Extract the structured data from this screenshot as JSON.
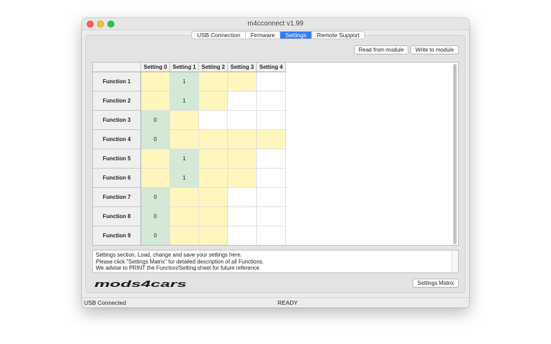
{
  "window": {
    "title": "m4cconnect v1.99"
  },
  "tabs": [
    {
      "label": "USB Connection",
      "active": false
    },
    {
      "label": "Firmware",
      "active": false
    },
    {
      "label": "Settings",
      "active": true
    },
    {
      "label": "Remote Support",
      "active": false
    }
  ],
  "toolbar": {
    "read_label": "Read from module",
    "write_label": "Write to module"
  },
  "matrix": {
    "columns": [
      "Setting 0",
      "Setting 1",
      "Setting 2",
      "Setting 3",
      "Setting 4"
    ],
    "rows": [
      {
        "label": "Function 1",
        "cells": [
          {
            "c": "y",
            "v": ""
          },
          {
            "c": "g",
            "v": "1"
          },
          {
            "c": "y",
            "v": ""
          },
          {
            "c": "y",
            "v": ""
          },
          {
            "c": "w",
            "v": ""
          }
        ]
      },
      {
        "label": "Function 2",
        "cells": [
          {
            "c": "y",
            "v": ""
          },
          {
            "c": "g",
            "v": "1"
          },
          {
            "c": "y",
            "v": ""
          },
          {
            "c": "w",
            "v": ""
          },
          {
            "c": "w",
            "v": ""
          }
        ]
      },
      {
        "label": "Function 3",
        "cells": [
          {
            "c": "g",
            "v": "0"
          },
          {
            "c": "y",
            "v": ""
          },
          {
            "c": "w",
            "v": ""
          },
          {
            "c": "w",
            "v": ""
          },
          {
            "c": "w",
            "v": ""
          }
        ]
      },
      {
        "label": "Function 4",
        "cells": [
          {
            "c": "g",
            "v": "0"
          },
          {
            "c": "y",
            "v": ""
          },
          {
            "c": "y",
            "v": ""
          },
          {
            "c": "y",
            "v": ""
          },
          {
            "c": "y",
            "v": ""
          }
        ]
      },
      {
        "label": "Function 5",
        "cells": [
          {
            "c": "y",
            "v": ""
          },
          {
            "c": "g",
            "v": "1"
          },
          {
            "c": "y",
            "v": ""
          },
          {
            "c": "y",
            "v": ""
          },
          {
            "c": "w",
            "v": ""
          }
        ]
      },
      {
        "label": "Function 6",
        "cells": [
          {
            "c": "y",
            "v": ""
          },
          {
            "c": "g",
            "v": "1"
          },
          {
            "c": "y",
            "v": ""
          },
          {
            "c": "y",
            "v": ""
          },
          {
            "c": "w",
            "v": ""
          }
        ]
      },
      {
        "label": "Function 7",
        "cells": [
          {
            "c": "g",
            "v": "0"
          },
          {
            "c": "y",
            "v": ""
          },
          {
            "c": "y",
            "v": ""
          },
          {
            "c": "w",
            "v": ""
          },
          {
            "c": "w",
            "v": ""
          }
        ]
      },
      {
        "label": "Function 8",
        "cells": [
          {
            "c": "g",
            "v": "0"
          },
          {
            "c": "y",
            "v": ""
          },
          {
            "c": "y",
            "v": ""
          },
          {
            "c": "w",
            "v": ""
          },
          {
            "c": "w",
            "v": ""
          }
        ]
      },
      {
        "label": "Function 9",
        "cells": [
          {
            "c": "g",
            "v": "0"
          },
          {
            "c": "y",
            "v": ""
          },
          {
            "c": "y",
            "v": ""
          },
          {
            "c": "w",
            "v": ""
          },
          {
            "c": "w",
            "v": ""
          }
        ]
      }
    ]
  },
  "description": {
    "line1": "Settings section. Load, change and save your settings here.",
    "line2": "Please click \"Settings Matrix\" for detailed description of all Functions.",
    "line3": "We advise to PRINT the Function/Setting sheet for future reference."
  },
  "logo": {
    "text": "mods4cars"
  },
  "footer": {
    "matrix_label": "Settings Matrix"
  },
  "statusbar": {
    "connection": "USB Connected",
    "state": "READY"
  },
  "colors": {
    "accent": "#2f7cf6",
    "cell_selected": "#d4e8d6",
    "cell_available": "#fff6bd",
    "cell_unavailable": "#ffffff"
  }
}
